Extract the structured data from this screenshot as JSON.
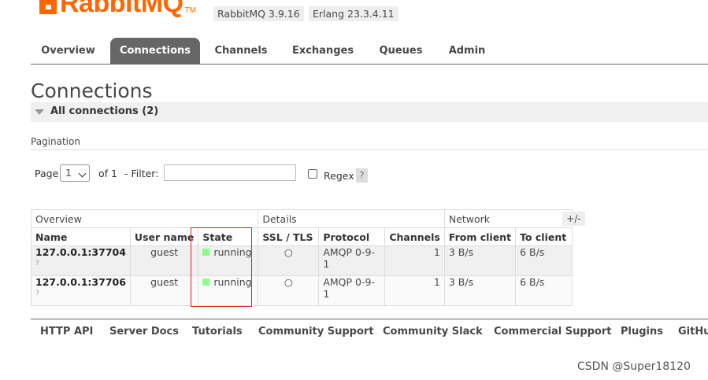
{
  "header": {
    "logo_text": "RabbitMQ",
    "logo_tm": "TM",
    "rabbitmq_version": "RabbitMQ 3.9.16",
    "erlang_version": "Erlang 23.3.4.11"
  },
  "tabs": [
    {
      "label": "Overview"
    },
    {
      "label": "Connections",
      "active": true
    },
    {
      "label": "Channels"
    },
    {
      "label": "Exchanges"
    },
    {
      "label": "Queues"
    },
    {
      "label": "Admin"
    }
  ],
  "page": {
    "title": "Connections",
    "section_label": "All connections (2)",
    "pagination_label": "Pagination"
  },
  "controls": {
    "page_label": "Page",
    "page_value": "1",
    "of_label": "of 1",
    "filter_label": "- Filter:",
    "filter_value": "",
    "regex_label": "Regex",
    "help_label": "?",
    "columns_toggle": "+/-"
  },
  "table": {
    "groups": [
      "Overview",
      "Details",
      "Network"
    ],
    "columns": [
      "Name",
      "User name",
      "State",
      "SSL / TLS",
      "Protocol",
      "Channels",
      "From client",
      "To client"
    ],
    "rows": [
      {
        "name": "127.0.0.1:37704",
        "sub": "?",
        "user": "guest",
        "state": "running",
        "ssl": "○",
        "protocol": "AMQP 0-9-1",
        "channels": "1",
        "from_client": "3 B/s",
        "to_client": "6 B/s"
      },
      {
        "name": "127.0.0.1:37706",
        "sub": "?",
        "user": "guest",
        "state": "running",
        "ssl": "○",
        "protocol": "AMQP 0-9-1",
        "channels": "1",
        "from_client": "3 B/s",
        "to_client": "6 B/s"
      }
    ]
  },
  "footer": {
    "links": [
      "HTTP API",
      "Server Docs",
      "Tutorials",
      "Community Support",
      "Community Slack",
      "Commercial Support",
      "Plugins",
      "GitHu"
    ]
  },
  "watermark": "CSDN @Super18120",
  "colors": {
    "brand": "#ff6600",
    "tab_active": "#666666",
    "state_running": "#88ff88",
    "highlight_box": "#e02020"
  }
}
